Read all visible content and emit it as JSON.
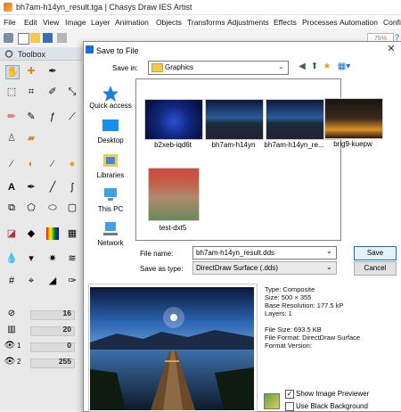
{
  "window": {
    "title": "bh7am-h14yn_result.tga | Chasys Draw IES Artist"
  },
  "menu": [
    "File",
    "Edit",
    "View",
    "Image",
    "Layer",
    "Animation",
    "Objects",
    "Transforms",
    "Adjustments",
    "Effects",
    "Processes",
    "Automation",
    "Confi"
  ],
  "toolbar": {
    "zoom": "75%"
  },
  "toolbox": {
    "title": "Toolbox",
    "sliders": [
      {
        "icon": "size-icon",
        "value": "16"
      },
      {
        "icon": "bars-icon",
        "value": "20"
      },
      {
        "icon": "eye-icon",
        "label": "1",
        "value": "0"
      },
      {
        "icon": "eye-icon",
        "label": "2",
        "value": "255"
      }
    ]
  },
  "dialog": {
    "title": "Save to File",
    "save_in_label": "Save in:",
    "save_in_value": "Graphics",
    "places": [
      {
        "label": "Quick access",
        "icon": "star-icon"
      },
      {
        "label": "Desktop",
        "icon": "desktop-icon"
      },
      {
        "label": "Libraries",
        "icon": "libraries-icon"
      },
      {
        "label": "This PC",
        "icon": "computer-icon"
      },
      {
        "label": "Network",
        "icon": "network-icon"
      }
    ],
    "files": [
      {
        "name": "b2xeb-iqd6t"
      },
      {
        "name": "bh7am-h14yn"
      },
      {
        "name": "bh7am-h14yn_re..."
      },
      {
        "name": "brig9-kuepw"
      },
      {
        "name": "test-dxt5"
      }
    ],
    "file_name_label": "File name:",
    "file_name_value": "bh7am-h14yn_result.dds",
    "save_as_type_label": "Save as type:",
    "save_as_type_value": "DirectDraw Surface (.dds)",
    "save_button": "Save",
    "cancel_button": "Cancel",
    "info": [
      "Type: Composite",
      "Size: 500 × 355",
      "Base Resolution: 177.5 kP",
      "Layers: 1",
      "",
      "File Size: 693.5 KB",
      "File Format: DirectDraw Surface",
      "Format Version:"
    ],
    "show_previewer_label": "Show Image Previewer",
    "show_previewer_checked": true,
    "black_background_label": "Use Black Background",
    "black_background_checked": false
  }
}
